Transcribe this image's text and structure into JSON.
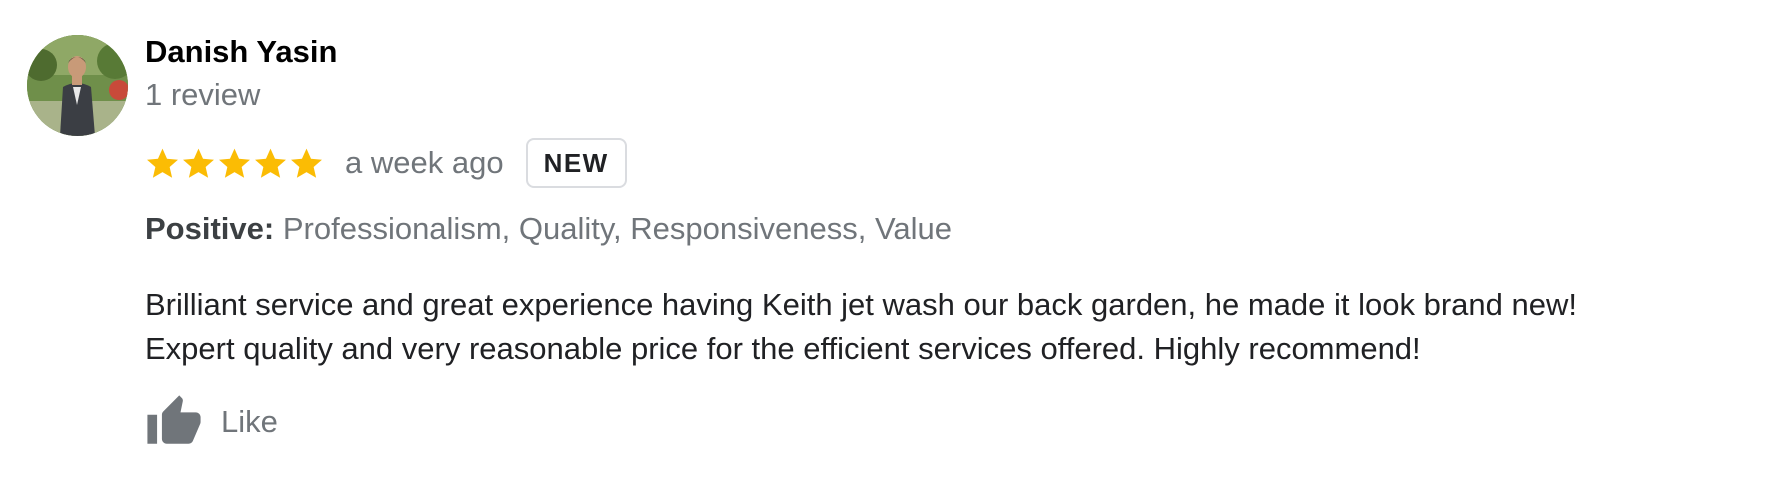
{
  "reviewer": {
    "name": "Danish Yasin",
    "review_count": "1 review"
  },
  "rating": {
    "stars": 5,
    "max": 5,
    "star_color": "#fbbc04"
  },
  "meta": {
    "time": "a week ago",
    "badge": "NEW"
  },
  "attributes": {
    "label": "Positive:",
    "values": "Professionalism, Quality, Responsiveness, Value"
  },
  "review": {
    "lines": [
      "Brilliant service and great experience having Keith jet wash our back garden, he made it look brand new!",
      "Expert quality and very reasonable price for the efficient services offered. Highly recommend!"
    ]
  },
  "actions": {
    "like_label": "Like",
    "like_icon": "thumbs-up-icon"
  },
  "colors": {
    "secondary_text": "#70757a",
    "primary_text": "#202124",
    "icon": "#70757a"
  }
}
